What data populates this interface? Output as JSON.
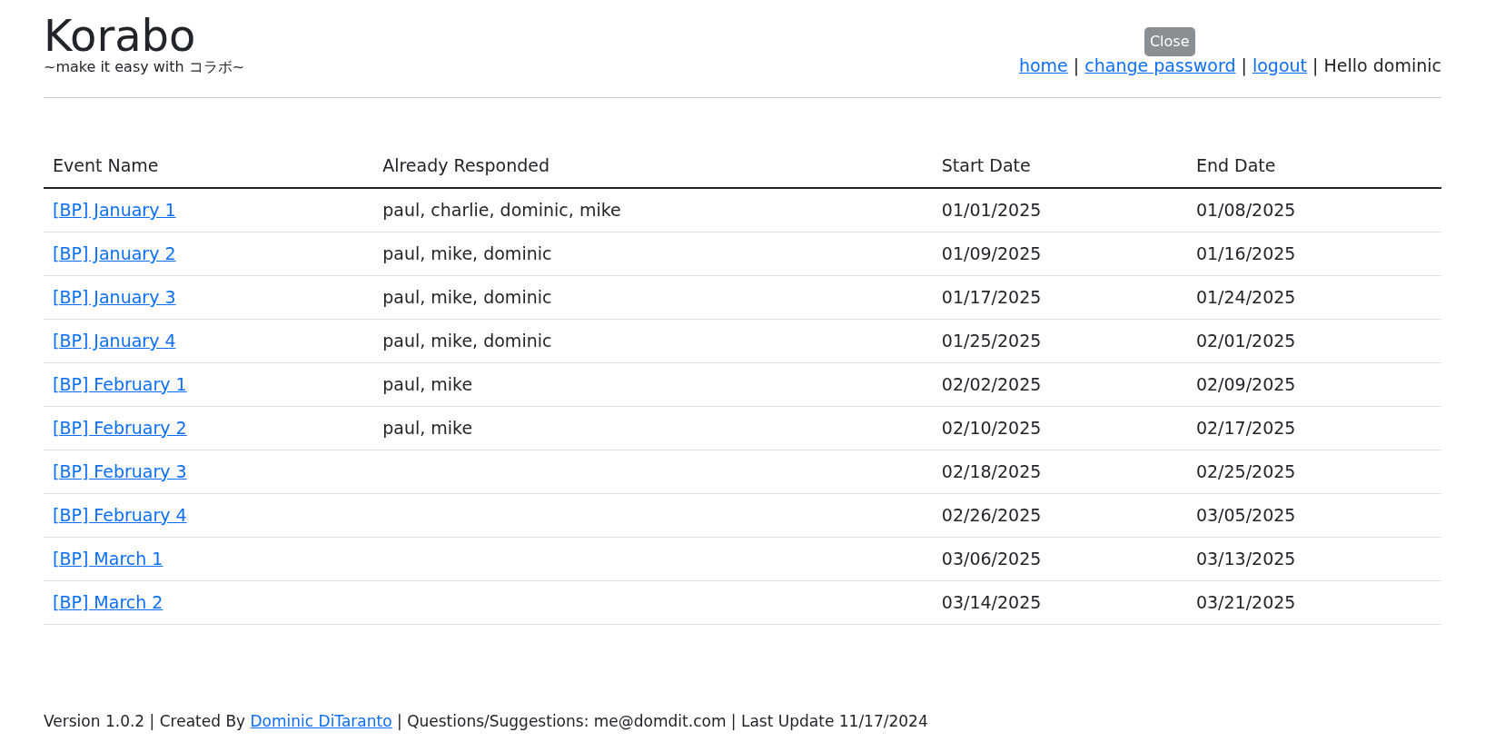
{
  "header": {
    "title": "Korabo",
    "tagline": "~make it easy with コラボ~",
    "nav": [
      {
        "kind": "link",
        "text": "home"
      },
      {
        "kind": "separator",
        "text": "|"
      },
      {
        "kind": "link",
        "text": "change password"
      },
      {
        "kind": "separator",
        "text": "|"
      },
      {
        "kind": "link",
        "text": "logout"
      },
      {
        "kind": "separator",
        "text": "|"
      },
      {
        "kind": "text",
        "text": "Hello dominic"
      }
    ],
    "tooltip": "Close"
  },
  "table": {
    "columns": [
      "Event Name",
      "Already Responded",
      "Start Date",
      "End Date"
    ],
    "rows": [
      {
        "event": "[BP] January 1",
        "responded": "paul, charlie, dominic, mike",
        "start": "01/01/2025",
        "end": "01/08/2025"
      },
      {
        "event": "[BP] January 2",
        "responded": "paul, mike, dominic",
        "start": "01/09/2025",
        "end": "01/16/2025"
      },
      {
        "event": "[BP] January 3",
        "responded": "paul, mike, dominic",
        "start": "01/17/2025",
        "end": "01/24/2025"
      },
      {
        "event": "[BP] January 4",
        "responded": "paul, mike, dominic",
        "start": "01/25/2025",
        "end": "02/01/2025"
      },
      {
        "event": "[BP] February 1",
        "responded": "paul, mike",
        "start": "02/02/2025",
        "end": "02/09/2025"
      },
      {
        "event": "[BP] February 2",
        "responded": "paul, mike",
        "start": "02/10/2025",
        "end": "02/17/2025"
      },
      {
        "event": "[BP] February 3",
        "start": "02/18/2025",
        "end": "02/25/2025"
      },
      {
        "event": "[BP] February 4",
        "start": "02/26/2025",
        "end": "03/05/2025"
      },
      {
        "event": "[BP] March 1",
        "start": "03/06/2025",
        "end": "03/13/2025"
      },
      {
        "event": "[BP] March 2",
        "start": "03/14/2025",
        "end": "03/21/2025"
      }
    ]
  },
  "footer": {
    "before": "Version 1.0.2 | Created By ",
    "link": "Dominic DiTaranto",
    "after": " | Questions/Suggestions: me@domdit.com | Last Update 11/17/2024"
  }
}
